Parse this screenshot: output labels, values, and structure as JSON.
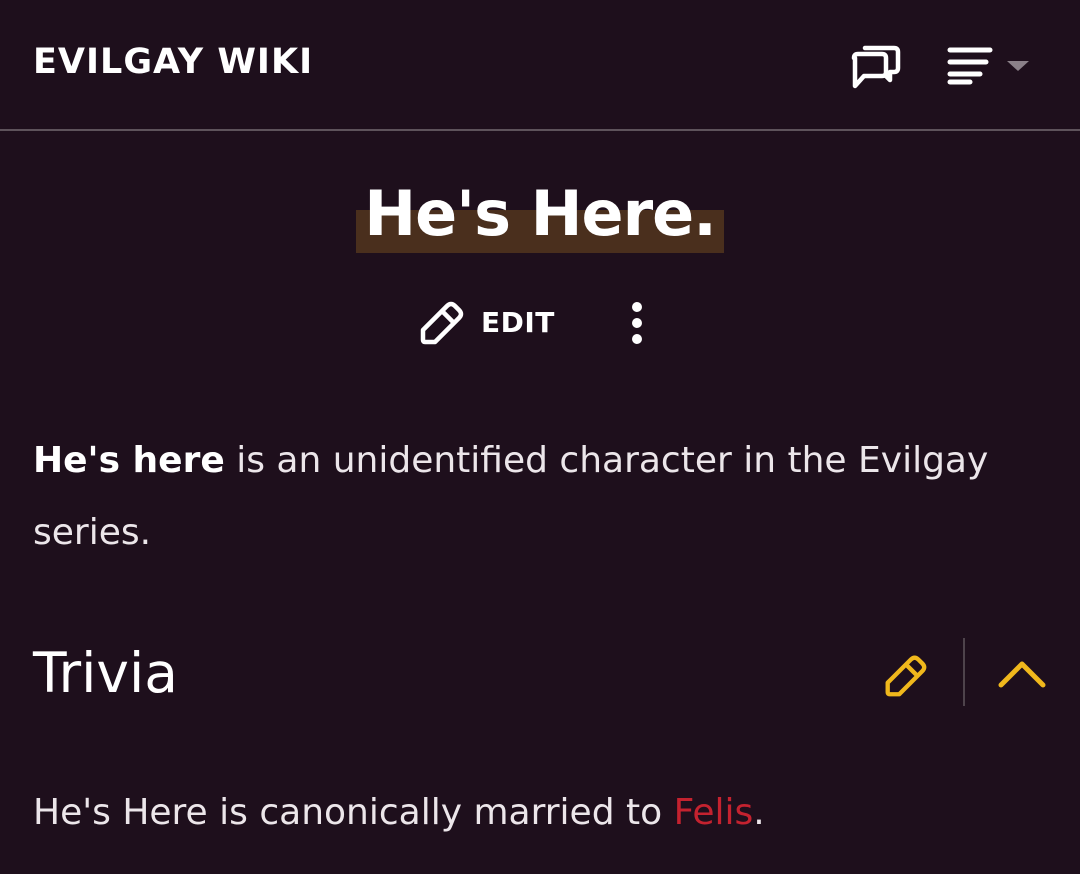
{
  "header": {
    "site_title": "EVILGAY WIKI"
  },
  "page": {
    "title": "He's Here.",
    "edit_label": "EDIT",
    "intro": {
      "bold": "He's here",
      "rest": " is an unidentified character in the Evilgay series."
    }
  },
  "section": {
    "heading": "Trivia",
    "text_before": "He's Here is canonically married to ",
    "link": "Felis",
    "text_after": "."
  },
  "colors": {
    "background": "#1e0f1c",
    "accent_yellow": "#f0b81c",
    "link_red": "#c4222f",
    "title_highlight": "#4a2f1d"
  },
  "icons": {
    "discuss": "discussion-icon",
    "menu": "menu-icon",
    "menu_caret": "caret-down-icon",
    "edit": "pencil-icon",
    "more": "more-vertical-icon",
    "section_edit": "pencil-icon",
    "collapse": "chevron-up-icon"
  }
}
